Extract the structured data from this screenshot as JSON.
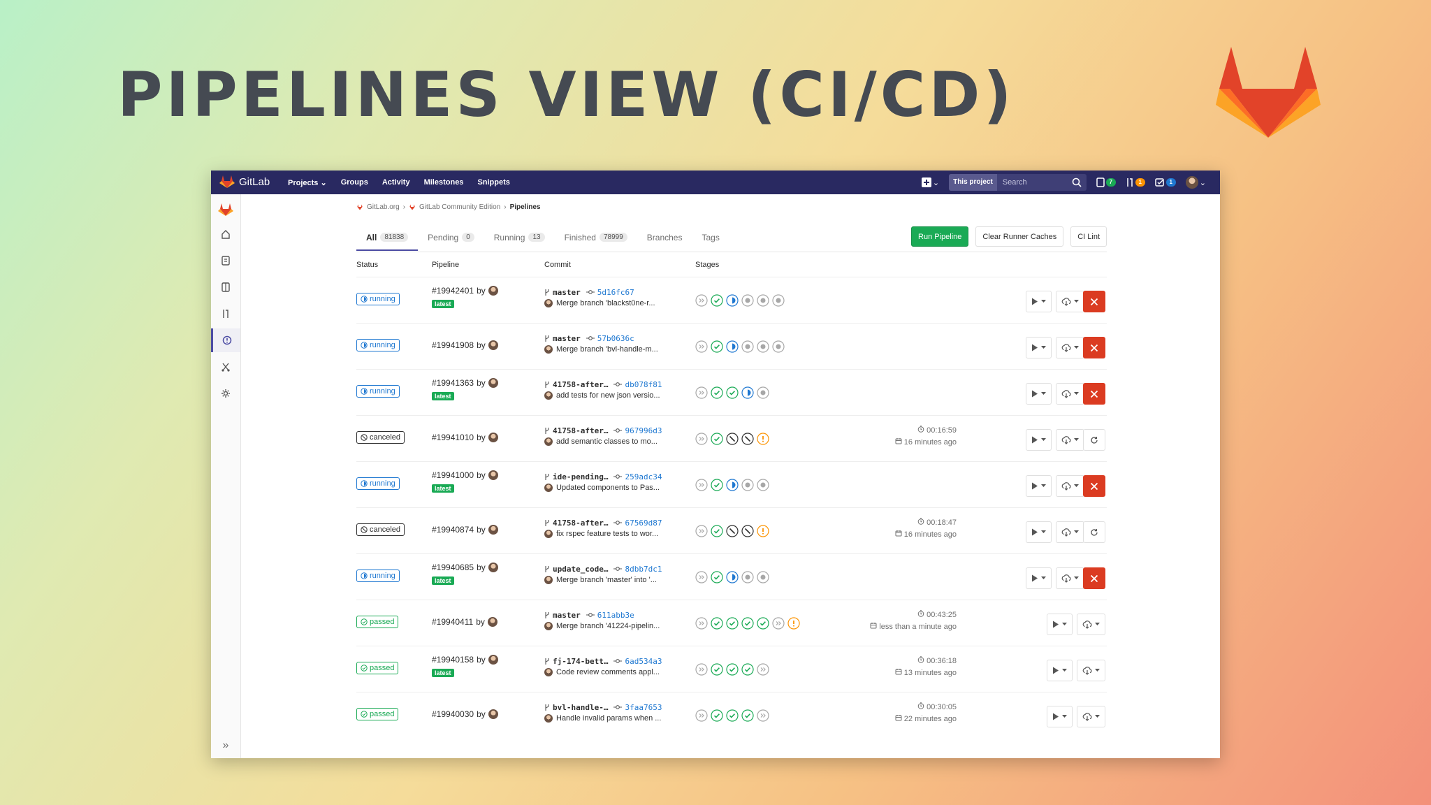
{
  "slide": {
    "title": "PIPELINES VIEW (CI/CD)"
  },
  "colors": {
    "navbar": "#292961",
    "success": "#1aaa55",
    "running": "#1f78d1",
    "danger": "#db3b21",
    "warning": "#fc9403"
  },
  "topbar": {
    "brand": "GitLab",
    "nav": [
      {
        "label": "Projects",
        "icon": "chevron-down-icon"
      },
      {
        "label": "Groups"
      },
      {
        "label": "Activity"
      },
      {
        "label": "Milestones"
      },
      {
        "label": "Snippets"
      }
    ],
    "search_scope": "This project",
    "search_placeholder": "Search",
    "issues_count": "7",
    "mr_count": "1",
    "todos_count": "1"
  },
  "sidebar": [
    "home-icon",
    "project-icon",
    "issues-icon",
    "merge-request-icon",
    "ci-cd-icon",
    "operations-icon",
    "settings-icon"
  ],
  "breadcrumb": [
    {
      "label": "GitLab.org"
    },
    {
      "label": "GitLab Community Edition"
    },
    {
      "label": "Pipelines"
    }
  ],
  "tabs": [
    {
      "label": "All",
      "count": "81838"
    },
    {
      "label": "Pending",
      "count": "0"
    },
    {
      "label": "Running",
      "count": "13"
    },
    {
      "label": "Finished",
      "count": "78999"
    },
    {
      "label": "Branches",
      "count": ""
    },
    {
      "label": "Tags",
      "count": ""
    }
  ],
  "actions": {
    "run": "Run Pipeline",
    "clear": "Clear Runner Caches",
    "lint": "CI Lint"
  },
  "columns": {
    "status": "Status",
    "pipeline": "Pipeline",
    "commit": "Commit",
    "stages": "Stages"
  },
  "pipelines": [
    {
      "status": "running",
      "id": "#19942401",
      "by": "by",
      "latest": "latest",
      "ref": "master",
      "sha": "5d16fc67",
      "message": "Merge branch 'blackst0ne-r...",
      "stages": [
        "skipped",
        "success",
        "running",
        "created",
        "created",
        "created"
      ],
      "duration": "",
      "finished": "",
      "cancelable": true
    },
    {
      "status": "running",
      "id": "#19941908",
      "by": "by",
      "latest": "",
      "ref": "master",
      "sha": "57b0636c",
      "message": "Merge branch 'bvl-handle-m...",
      "stages": [
        "skipped",
        "success",
        "running",
        "created",
        "created",
        "created"
      ],
      "duration": "",
      "finished": "",
      "cancelable": true
    },
    {
      "status": "running",
      "id": "#19941363",
      "by": "by",
      "latest": "latest",
      "ref": "41758-after…",
      "sha": "db078f81",
      "message": "add tests for new json versio...",
      "stages": [
        "skipped",
        "success",
        "success",
        "running",
        "created"
      ],
      "duration": "",
      "finished": "",
      "cancelable": true
    },
    {
      "status": "canceled",
      "id": "#19941010",
      "by": "by",
      "latest": "",
      "ref": "41758-after…",
      "sha": "967996d3",
      "message": "add semantic classes to mo...",
      "stages": [
        "skipped",
        "success",
        "canceled",
        "canceled",
        "warning"
      ],
      "duration": "00:16:59",
      "finished": "16 minutes ago",
      "cancelable": false
    },
    {
      "status": "running",
      "id": "#19941000",
      "by": "by",
      "latest": "latest",
      "ref": "ide-pending…",
      "sha": "259adc34",
      "message": "Updated components to Pas...",
      "stages": [
        "skipped",
        "success",
        "running",
        "created",
        "created"
      ],
      "duration": "",
      "finished": "",
      "cancelable": true
    },
    {
      "status": "canceled",
      "id": "#19940874",
      "by": "by",
      "latest": "",
      "ref": "41758-after…",
      "sha": "67569d87",
      "message": "fix rspec feature tests to wor...",
      "stages": [
        "skipped",
        "success",
        "canceled",
        "canceled",
        "warning"
      ],
      "duration": "00:18:47",
      "finished": "16 minutes ago",
      "cancelable": false
    },
    {
      "status": "running",
      "id": "#19940685",
      "by": "by",
      "latest": "latest",
      "ref": "update_code…",
      "sha": "8dbb7dc1",
      "message": "Merge branch 'master' into '...",
      "stages": [
        "skipped",
        "success",
        "running",
        "created",
        "created"
      ],
      "duration": "",
      "finished": "",
      "cancelable": true
    },
    {
      "status": "passed",
      "id": "#19940411",
      "by": "by",
      "latest": "",
      "ref": "master",
      "sha": "611abb3e",
      "message": "Merge branch '41224-pipelin...",
      "stages": [
        "skipped",
        "success",
        "success",
        "success",
        "success",
        "skipped",
        "warning"
      ],
      "duration": "00:43:25",
      "finished": "less than a minute ago",
      "cancelable": null
    },
    {
      "status": "passed",
      "id": "#19940158",
      "by": "by",
      "latest": "latest",
      "ref": "fj-174-bett…",
      "sha": "6ad534a3",
      "message": "Code review comments appl...",
      "stages": [
        "skipped",
        "success",
        "success",
        "success",
        "skipped"
      ],
      "duration": "00:36:18",
      "finished": "13 minutes ago",
      "cancelable": null
    },
    {
      "status": "passed",
      "id": "#19940030",
      "by": "by",
      "latest": "",
      "ref": "bvl-handle-…",
      "sha": "3faa7653",
      "message": "Handle invalid params when ...",
      "stages": [
        "skipped",
        "success",
        "success",
        "success",
        "skipped"
      ],
      "duration": "00:30:05",
      "finished": "22 minutes ago",
      "cancelable": null
    }
  ]
}
